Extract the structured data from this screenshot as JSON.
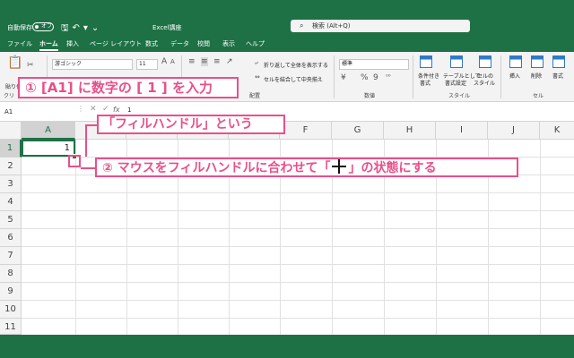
{
  "titlebar": {
    "autosave_label": "自動保存",
    "autosave_state": "オフ",
    "title": "Excel講座",
    "search_placeholder": "検索 (Alt+Q)"
  },
  "menu": [
    "ファイル",
    "ホーム",
    "挿入",
    "ページ レイアウト",
    "数式",
    "データ",
    "校閲",
    "表示",
    "ヘルプ"
  ],
  "ribbon": {
    "clipboard_group": "クリ",
    "font_name": "游ゴシック",
    "font_size": "11",
    "wrap_text": "折り返して全体を表示する",
    "merge_center": "セルを結合して中央揃え",
    "alignment_group": "配置",
    "number_format": "標準",
    "number_group": "数値",
    "conditional_format": [
      "条件付き",
      "書式"
    ],
    "format_as_table": [
      "テーブルとして",
      "書式設定"
    ],
    "cell_styles": [
      "セルの",
      "スタイル"
    ],
    "styles_group": "スタイル",
    "insert": "挿入",
    "delete": "削除",
    "format": "書式",
    "cells_group": "セル",
    "paste_label": "貼り付け"
  },
  "formulabar": {
    "namebox": "A1",
    "value": "1"
  },
  "grid": {
    "columns": [
      "A",
      "B",
      "C",
      "D",
      "E",
      "F",
      "G",
      "H",
      "I",
      "J",
      "K"
    ],
    "rows": [
      "1",
      "2",
      "3",
      "4",
      "5",
      "6",
      "7",
      "8",
      "9",
      "10",
      "11"
    ],
    "a1_value": "1"
  },
  "annotations": {
    "step1": "① [A1] に数字の [ 1 ] を入力",
    "fill_handle_label": "「フィルハンドル」という",
    "step2_before": "② マウスをフィルハンドルに合わせて「",
    "step2_after": "」の状態にする",
    "accent_color": "#e8508a"
  },
  "colors": {
    "excel_green": "#1e7145"
  }
}
